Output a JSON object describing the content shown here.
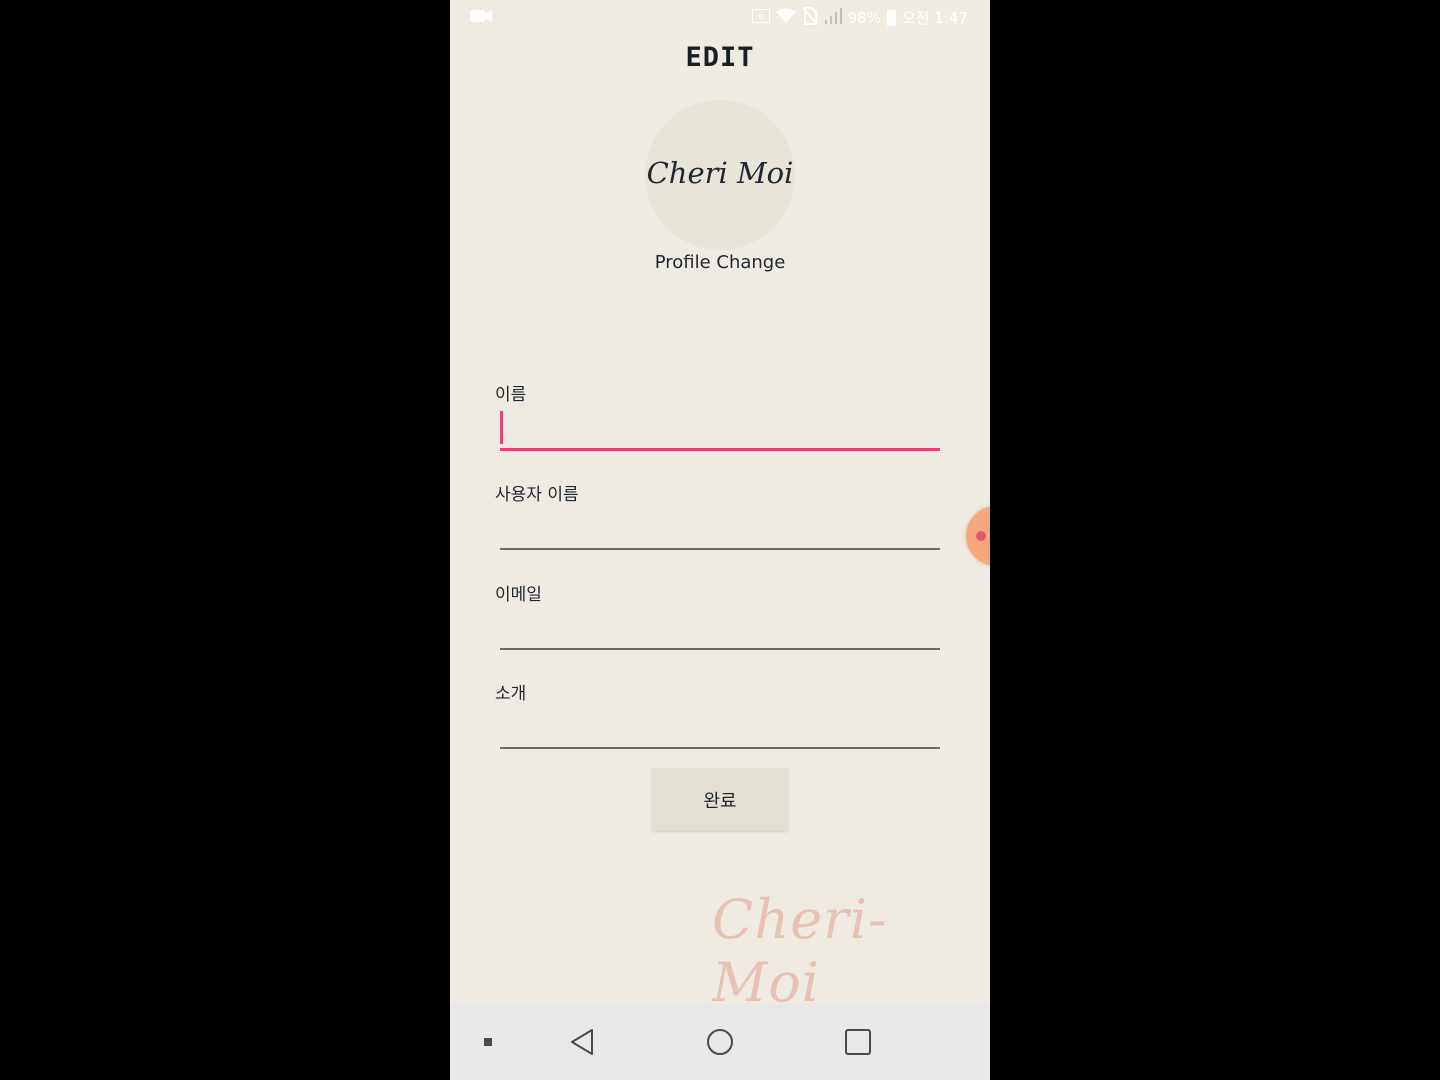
{
  "status_bar": {
    "battery_percent": "98%",
    "time": "오전 1:47",
    "icons": [
      "video-record-icon",
      "nfc-icon",
      "wifi-icon",
      "no-sim-icon",
      "signal-icon",
      "battery-icon"
    ]
  },
  "header": {
    "title": "EDIT"
  },
  "profile": {
    "avatar_logo": "Cheri Moi",
    "change_label": "Profile Change"
  },
  "form": {
    "fields": [
      {
        "label": "이름",
        "value": "",
        "focused": true
      },
      {
        "label": "사용자 이름",
        "value": ""
      },
      {
        "label": "이메일",
        "value": ""
      },
      {
        "label": "소개",
        "value": ""
      }
    ],
    "submit_label": "완료"
  },
  "watermark": "Cheri-Moi",
  "nav_bar": {
    "buttons": [
      "menu-dot-icon",
      "back-icon",
      "home-icon",
      "recents-icon"
    ]
  },
  "colors": {
    "background": "#efebe2",
    "accent_focus": "#e0457a",
    "button_bg": "#e3dfd3",
    "watermark": "#e6c2b4",
    "floating_handle": "#f6a87c",
    "nav_bar": "#e7e8ea"
  }
}
